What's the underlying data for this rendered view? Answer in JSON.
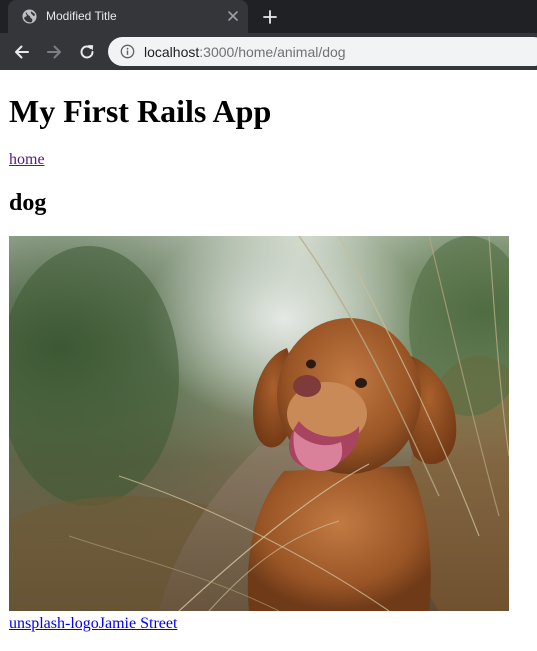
{
  "browser": {
    "tab": {
      "title": "Modified Title",
      "favicon_icon": "globe-icon",
      "close_icon": "close-icon"
    },
    "new_tab_icon": "plus-icon",
    "toolbar": {
      "back_icon": "arrow-left-icon",
      "forward_icon": "arrow-right-icon",
      "reload_icon": "reload-icon",
      "site_info_icon": "info-icon",
      "url_host": "localhost",
      "url_rest": ":3000/home/animal/dog"
    },
    "colors": {
      "tab_strip": "#202124",
      "active_tab": "#35363a",
      "omnibox": "#f1f3f4",
      "visited_link": "#551a8b",
      "link": "#0000ee"
    }
  },
  "page": {
    "heading": "My First Rails App",
    "home_link": "home",
    "animal_name": "dog",
    "photo_subject": "dog-photo",
    "credit": {
      "logo_alt_text": "unsplash-logo",
      "photographer": "Jamie Street"
    }
  }
}
